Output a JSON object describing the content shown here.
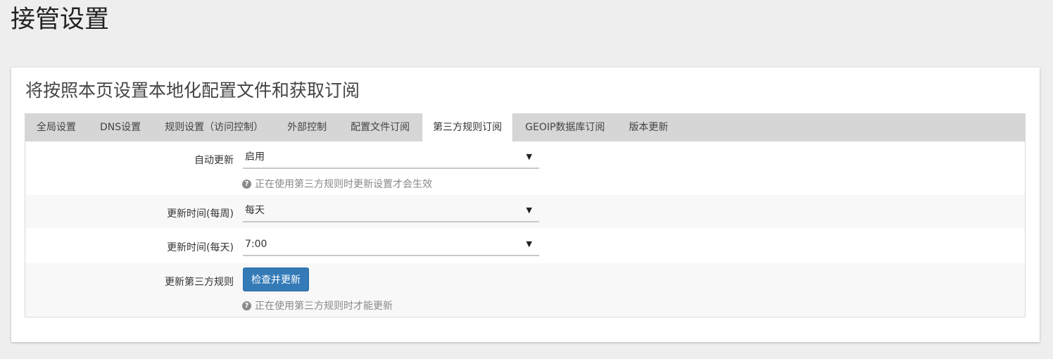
{
  "page": {
    "title": "接管设置",
    "card_title": "将按照本页设置本地化配置文件和获取订阅"
  },
  "tabs": [
    {
      "label": "全局设置",
      "active": false
    },
    {
      "label": "DNS设置",
      "active": false
    },
    {
      "label": "规则设置（访问控制）",
      "active": false
    },
    {
      "label": "外部控制",
      "active": false
    },
    {
      "label": "配置文件订阅",
      "active": false
    },
    {
      "label": "第三方规则订阅",
      "active": true
    },
    {
      "label": "GEOIP数据库订阅",
      "active": false
    },
    {
      "label": "版本更新",
      "active": false
    }
  ],
  "form": {
    "auto_update": {
      "label": "自动更新",
      "value": "启用",
      "hint": "正在使用第三方规则时更新设置才会生效"
    },
    "update_week": {
      "label": "更新时间(每周)",
      "value": "每天"
    },
    "update_day": {
      "label": "更新时间(每天)",
      "value": "7:00"
    },
    "update_rules": {
      "label": "更新第三方规则",
      "button": "检查并更新",
      "hint": "正在使用第三方规则时才能更新"
    }
  },
  "icons": {
    "caret": "caret-down-icon",
    "help": "question-circle-icon"
  },
  "colors": {
    "primary_button": "#337ab7",
    "tab_bar": "#d6d6d6",
    "background": "#eeeeee"
  }
}
